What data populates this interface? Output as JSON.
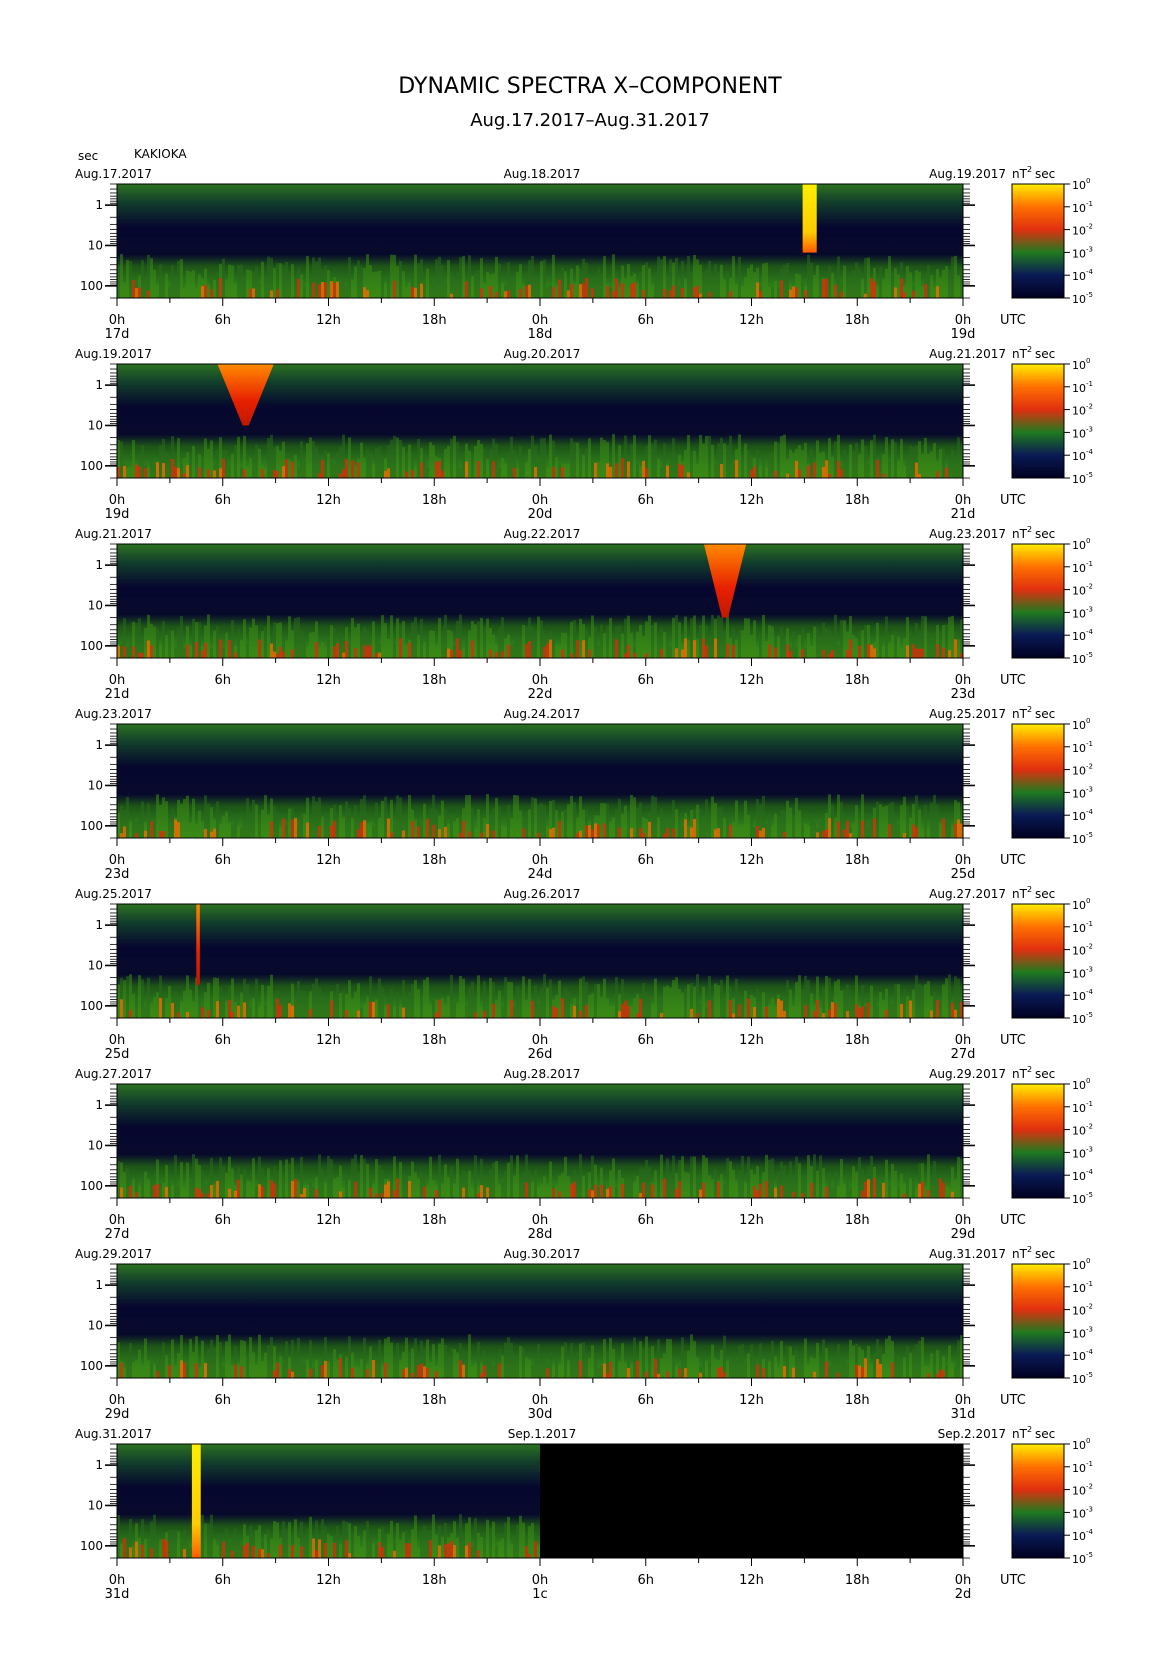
{
  "title": "DYNAMIC SPECTRA X–COMPONENT",
  "subtitle": "Aug.17.2017–Aug.31.2017",
  "y_unit_label": "sec",
  "station": "KAKIOKA",
  "utc_label": "UTC",
  "colorbar_unit": "nT",
  "colorbar_unit_sup": "2",
  "colorbar_unit_suffix": "sec",
  "colors": {
    "background": "#ffffff",
    "spectra_low": "#06062e",
    "spectra_mid": "#2a6e1e",
    "spectra_high": "#ff2a00",
    "spectra_max": "#ffee00",
    "no_data": "#000000"
  },
  "chart_data": {
    "type": "heatmap",
    "component": "X",
    "y_axis": {
      "label": "sec",
      "scale": "log",
      "ticks": [
        "1",
        "10",
        "100"
      ]
    },
    "x_axis": {
      "label": "UTC",
      "hour_ticks": [
        "0h",
        "6h",
        "12h",
        "18h",
        "0h",
        "6h",
        "12h",
        "18h",
        "0h"
      ]
    },
    "colorbar": {
      "scale": "log",
      "range": [
        1e-05,
        1
      ],
      "levels": [
        {
          "base": "10",
          "exp": "0"
        },
        {
          "base": "10",
          "exp": "-1"
        },
        {
          "base": "10",
          "exp": "-2"
        },
        {
          "base": "10",
          "exp": "-3"
        },
        {
          "base": "10",
          "exp": "-4"
        },
        {
          "base": "10",
          "exp": "-5"
        }
      ]
    },
    "panels": [
      {
        "start_date": "Aug.17.2017",
        "mid_date": "Aug.18.2017",
        "end_date": "Aug.19.2017",
        "day_labels": [
          "17d",
          "18d",
          "19d"
        ],
        "data_coverage": 1.0,
        "events": [
          {
            "hour": 39.3,
            "width_h": 0.8,
            "intensity": "max",
            "period_range_sec": [
              0.5,
              15
            ]
          }
        ]
      },
      {
        "start_date": "Aug.19.2017",
        "mid_date": "Aug.20.2017",
        "end_date": "Aug.21.2017",
        "day_labels": [
          "19d",
          "20d",
          "21d"
        ],
        "data_coverage": 1.0,
        "events": [
          {
            "hour": 7.3,
            "width_h": 1.6,
            "intensity": "high",
            "period_range_sec": [
              0.5,
              10
            ]
          }
        ]
      },
      {
        "start_date": "Aug.21.2017",
        "mid_date": "Aug.22.2017",
        "end_date": "Aug.23.2017",
        "day_labels": [
          "21d",
          "22d",
          "23d"
        ],
        "data_coverage": 1.0,
        "events": [
          {
            "hour": 34.5,
            "width_h": 1.2,
            "intensity": "high",
            "period_range_sec": [
              0.5,
              20
            ]
          }
        ]
      },
      {
        "start_date": "Aug.23.2017",
        "mid_date": "Aug.24.2017",
        "end_date": "Aug.25.2017",
        "day_labels": [
          "23d",
          "24d",
          "25d"
        ],
        "data_coverage": 1.0,
        "events": []
      },
      {
        "start_date": "Aug.25.2017",
        "mid_date": "Aug.26.2017",
        "end_date": "Aug.27.2017",
        "day_labels": [
          "25d",
          "26d",
          "27d"
        ],
        "data_coverage": 1.0,
        "events": [
          {
            "hour": 4.6,
            "width_h": 0.2,
            "intensity": "high",
            "period_range_sec": [
              0.5,
              30
            ]
          }
        ]
      },
      {
        "start_date": "Aug.27.2017",
        "mid_date": "Aug.28.2017",
        "end_date": "Aug.29.2017",
        "day_labels": [
          "27d",
          "28d",
          "29d"
        ],
        "data_coverage": 1.0,
        "events": []
      },
      {
        "start_date": "Aug.29.2017",
        "mid_date": "Aug.30.2017",
        "end_date": "Aug.31.2017",
        "day_labels": [
          "29d",
          "30d",
          "31d"
        ],
        "data_coverage": 1.0,
        "events": []
      },
      {
        "start_date": "Aug.31.2017",
        "mid_date": "Sep.1.2017",
        "end_date": "Sep.2.2017",
        "day_labels": [
          "31d",
          "1c",
          "2d"
        ],
        "data_coverage": 0.5,
        "events": [
          {
            "hour": 4.5,
            "width_h": 0.5,
            "intensity": "max",
            "period_range_sec": [
              0.5,
              200
            ]
          }
        ]
      }
    ]
  }
}
